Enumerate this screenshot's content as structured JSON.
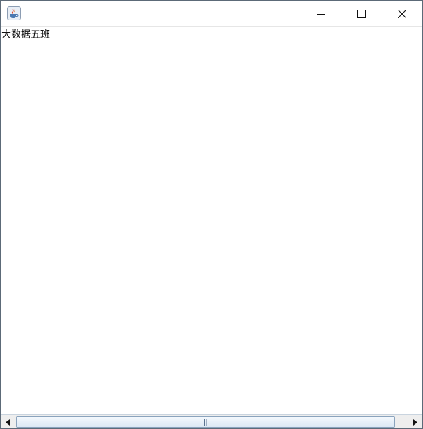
{
  "window": {
    "app_icon": "java-coffee-cup-icon",
    "caption_buttons": [
      "minimize-icon",
      "maximize-icon",
      "close-icon"
    ]
  },
  "content": {
    "label": "大数据五班"
  },
  "scrollbar": {
    "left_arrow": "arrow-left-icon",
    "right_arrow": "arrow-right-icon",
    "thumb_grip": "grip-icon"
  },
  "colors": {
    "border": "#5c6a78",
    "thumb_border": "#8aa3bd",
    "background": "#ffffff"
  }
}
